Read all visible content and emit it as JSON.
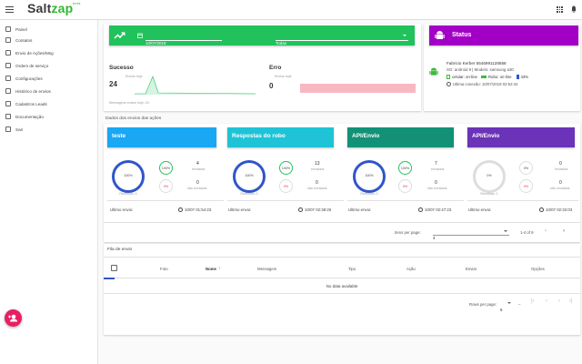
{
  "app": {
    "logo_main": "Salt",
    "logo_accent": "zap",
    "logo_sub": "beta",
    "icons": [
      "menu-icon",
      "apps-grid-icon",
      "bell-icon"
    ]
  },
  "sidebar": {
    "items": [
      {
        "label": "Painel",
        "icon": "dashboard-icon"
      },
      {
        "label": "Contatos",
        "icon": "contacts-icon"
      },
      {
        "label": "Envio de Ações/Msg",
        "icon": "send-icon"
      },
      {
        "label": "Ordem de serviço",
        "icon": "clipboard-icon"
      },
      {
        "label": "Configurações",
        "icon": "settings-icon"
      },
      {
        "label": "Histórico de envios",
        "icon": "history-icon"
      },
      {
        "label": "Cadastros Leads",
        "icon": "leads-icon"
      },
      {
        "label": "Documentação",
        "icon": "docs-icon"
      },
      {
        "label": "Sair",
        "icon": "logout-icon"
      }
    ],
    "fab_icon": "add-user-icon"
  },
  "filter": {
    "date": "10/07/2019",
    "select_value": "Todas"
  },
  "stats": {
    "success_label": "Sucesso",
    "success_sub": "Envios hoje",
    "success_value": "24",
    "error_label": "Erro",
    "error_sub": "Envios hoje",
    "error_value": "0",
    "note": "Mensagens envios hoje: 24"
  },
  "status": {
    "title": "Status",
    "device_name": "Fabricio Kerber 5546991128568",
    "device_info": "SO: android 9 | Modelo: samsung a30",
    "celular_text": "celular: on-line",
    "robo_text": "Robo: on-line",
    "battery_text": "43%",
    "last_connection": "Ultima conexão: 10/07/2019 02:52:44"
  },
  "section_title": "Dados dos envios das ações",
  "actions": [
    {
      "name": "teste",
      "color": "#1aa7f4",
      "center": "100%",
      "center_sub": "Recebido: 0",
      "success_pct": "100%",
      "fail_pct": "0%",
      "sent": "4",
      "sent_lbl": "enviados",
      "notsent": "0",
      "notsent_lbl": "não enviados",
      "last_label": "Ultimo envio:",
      "last_time": "10/07 01:54:23",
      "ring": "#2f56c9"
    },
    {
      "name": "Respostas do robo",
      "color": "#1fc3d6",
      "center": "100%",
      "center_sub": "Recebido: 0",
      "success_pct": "100%",
      "fail_pct": "0%",
      "sent": "13",
      "sent_lbl": "enviados",
      "notsent": "0",
      "notsent_lbl": "não enviados",
      "last_label": "Ultimo envio:",
      "last_time": "10/07 02:38:26",
      "ring": "#2f56c9"
    },
    {
      "name": "API/Envio",
      "color": "#129177",
      "center": "100%",
      "center_sub": "Recebido: 0",
      "success_pct": "100%",
      "fail_pct": "0%",
      "sent": "7",
      "sent_lbl": "enviados",
      "notsent": "0",
      "notsent_lbl": "não enviados",
      "last_label": "Ultimo envio:",
      "last_time": "10/07 02:47:23",
      "ring": "#2f56c9"
    },
    {
      "name": "API/Envio",
      "color": "#6a33b8",
      "center": "0%",
      "center_sub": "Recebido: 1",
      "success_pct": "0%",
      "fail_pct": "0%",
      "sent": "0",
      "sent_lbl": "enviados",
      "notsent": "0",
      "notsent_lbl": "não enviados",
      "last_label": "Ultimo envio:",
      "last_time": "10/07 02:32:03",
      "ring": "#dddddd"
    }
  ],
  "pager1": {
    "label": "Itens per page:",
    "value": "4",
    "range": "1-4 of 9"
  },
  "queue": {
    "title": "Fila de envio",
    "columns": [
      "Foto",
      "Nome",
      "Mensagem",
      "Tipo",
      "Ação",
      "Enviar",
      "Opções"
    ],
    "empty": "No data available",
    "rows_label": "Rows per page:",
    "rows_value": "5",
    "range": "–"
  }
}
